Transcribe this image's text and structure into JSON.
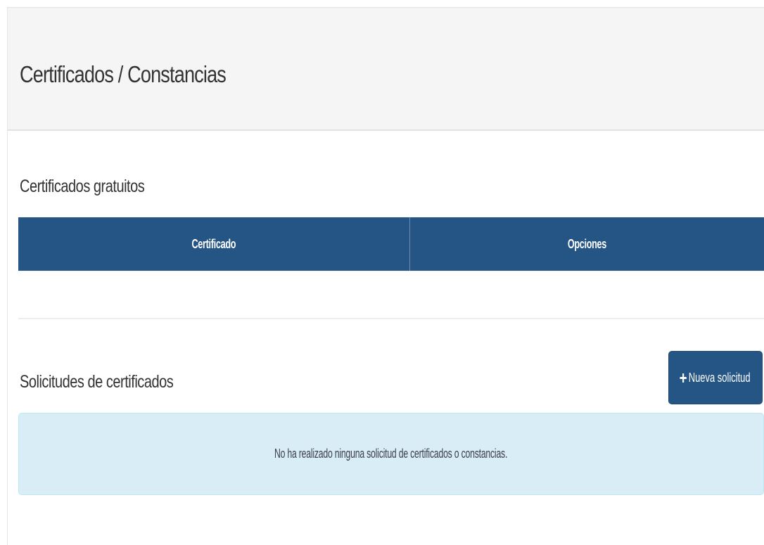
{
  "panel": {
    "title": "Certificados / Constancias"
  },
  "free_certificates": {
    "title": "Certificados gratuitos",
    "table": {
      "columns": [
        "Certificado",
        "Opciones"
      ],
      "rows": []
    }
  },
  "requests": {
    "title": "Solicitudes de certificados",
    "new_request_button": {
      "icon": "plus-icon",
      "label": "Nueva solicitud"
    },
    "empty_message": "No ha realizado ninguna solicitud de certificados o constancias."
  },
  "colors": {
    "primary": "#255584",
    "info_background": "#d9edf7",
    "heading_background": "#f5f5f5"
  }
}
